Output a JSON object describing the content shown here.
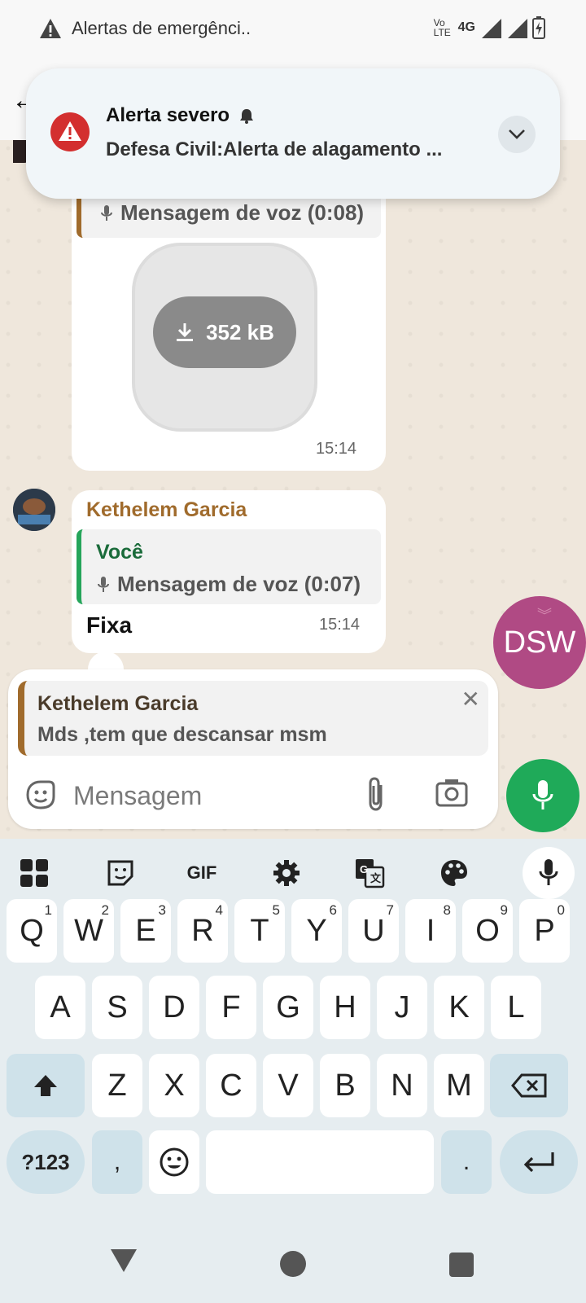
{
  "status_bar": {
    "notification_text": "Alertas de emergênci..",
    "network": "4G",
    "volte": "Vo LTE"
  },
  "alert": {
    "title": "Alerta severo",
    "body": "Defesa Civil:Alerta de alagamento ..."
  },
  "messages": [
    {
      "quote_text": "Mensagem de voz (0:08)",
      "download_size": "352 kB",
      "time": "15:14"
    },
    {
      "sender": "Kethelem Garcia",
      "quote_name": "Você",
      "quote_text": "Mensagem de voz (0:07)",
      "text": "Fixa",
      "time": "15:14"
    }
  ],
  "floating_button": {
    "label": "DSW"
  },
  "reply": {
    "name": "Kethelem Garcia",
    "text": "Mds ,tem que descansar msm"
  },
  "composer": {
    "placeholder": "Mensagem"
  },
  "keyboard": {
    "toolbar": [
      "apps",
      "sticker",
      "GIF",
      "settings",
      "translate",
      "theme",
      "voice"
    ],
    "gif_label": "GIF",
    "row1": [
      {
        "k": "Q",
        "h": "1"
      },
      {
        "k": "W",
        "h": "2"
      },
      {
        "k": "E",
        "h": "3"
      },
      {
        "k": "R",
        "h": "4"
      },
      {
        "k": "T",
        "h": "5"
      },
      {
        "k": "Y",
        "h": "6"
      },
      {
        "k": "U",
        "h": "7"
      },
      {
        "k": "I",
        "h": "8"
      },
      {
        "k": "O",
        "h": "9"
      },
      {
        "k": "P",
        "h": "0"
      }
    ],
    "row2": [
      "A",
      "S",
      "D",
      "F",
      "G",
      "H",
      "J",
      "K",
      "L"
    ],
    "row3": [
      "Z",
      "X",
      "C",
      "V",
      "B",
      "N",
      "M"
    ],
    "symbols_label": "?123",
    "comma_label": ",",
    "period_label": "."
  },
  "colors": {
    "accent_green": "#1faa59",
    "quote_brown": "#a06b2c",
    "alert_red": "#d32f2f",
    "dsw_purple": "#b04a84"
  }
}
